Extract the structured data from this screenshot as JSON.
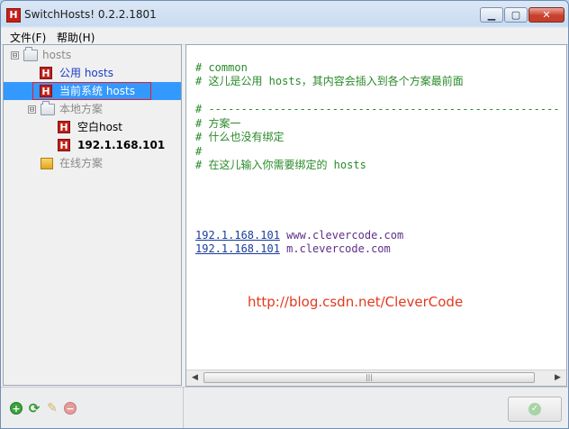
{
  "window": {
    "title": "SwitchHosts! 0.2.2.1801",
    "app_icon": "H",
    "controls": {
      "minimize": "▁",
      "maximize": "▢",
      "close": "✕"
    }
  },
  "menu": {
    "file": "文件(F)",
    "help": "帮助(H)"
  },
  "sidebar": {
    "root": {
      "label": "hosts",
      "expander": "⊟"
    },
    "common": {
      "label": "公用 hosts"
    },
    "current": {
      "label": "当前系统 hosts"
    },
    "local": {
      "label": "本地方案",
      "expander": "⊟"
    },
    "local_items": [
      {
        "label": "空白host"
      },
      {
        "label": "192.1.168.101"
      }
    ],
    "online": {
      "label": "在线方案"
    }
  },
  "editor": {
    "lines": [
      "# common",
      "# 这儿是公用 hosts，其内容会插入到各个方案最前面",
      "",
      "# ------------------------------------------------------",
      "# 方案一",
      "# 什么也没有绑定",
      "#",
      "# 在这儿输入你需要绑定的 hosts",
      "",
      "",
      "",
      ""
    ],
    "entries": [
      {
        "ip": "192.1.168.101",
        "host": "www.clevercode.com"
      },
      {
        "ip": "192.1.168.101",
        "host": "m.clevercode.com"
      }
    ],
    "watermark": "http://blog.csdn.net/CleverCode",
    "scroll_left": "◀",
    "scroll_right": "▶",
    "scroll_grip": "|||"
  },
  "toolbar": {
    "add_icon": "+",
    "refresh_icon": "⟳",
    "edit_icon": "✎",
    "delete_icon": "−",
    "apply_icon": "✓"
  },
  "colors": {
    "accent": "#3399ff",
    "brand": "#c01f19",
    "comment": "#2a8a2a"
  }
}
